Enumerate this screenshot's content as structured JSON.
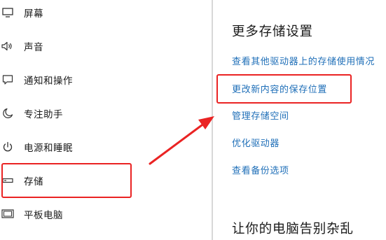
{
  "sidebar": {
    "items": [
      {
        "label": "屏幕",
        "icon": "display-icon"
      },
      {
        "label": "声音",
        "icon": "speaker-icon"
      },
      {
        "label": "通知和操作",
        "icon": "notification-icon"
      },
      {
        "label": "专注助手",
        "icon": "moon-icon"
      },
      {
        "label": "电源和睡眠",
        "icon": "power-icon"
      },
      {
        "label": "存储",
        "icon": "storage-drive-icon",
        "active": true
      },
      {
        "label": "平板电脑",
        "icon": "tablet-icon"
      }
    ]
  },
  "content": {
    "section1_title": "更多存储设置",
    "links": [
      "查看其他驱动器上的存储使用情况",
      "更改新内容的保存位置",
      "管理存储空间",
      "优化驱动器",
      "查看备份选项"
    ],
    "section2_title": "让你的电脑告别杂乱"
  },
  "colors": {
    "link": "#1f6fb8",
    "annotation": "#ea2323",
    "text": "#1a1a1a"
  }
}
